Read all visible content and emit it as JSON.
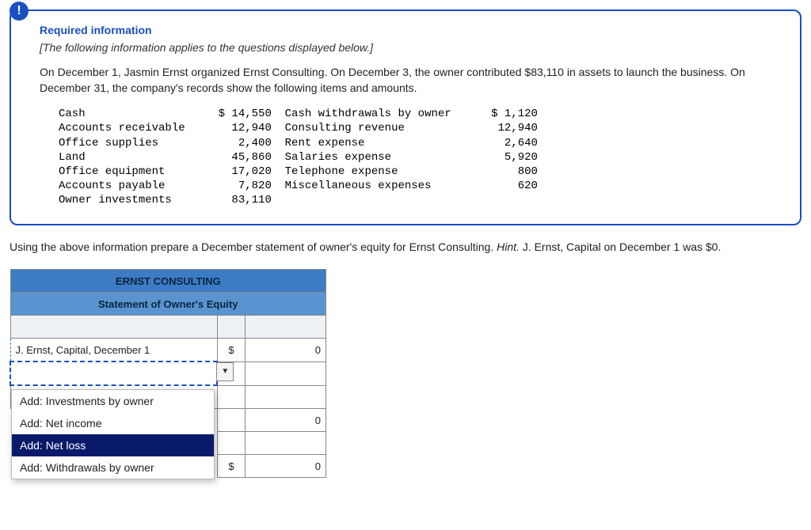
{
  "info": {
    "title": "Required information",
    "subtitle": "[The following information applies to the questions displayed below.]",
    "paragraph": "On December 1, Jasmin Ernst organized Ernst Consulting. On December 3, the owner contributed $83,110 in assets to launch the business. On December 31, the company's records show the following items and amounts."
  },
  "ledger": {
    "left": [
      {
        "name": "Cash",
        "amount": "$ 14,550"
      },
      {
        "name": "Accounts receivable",
        "amount": "12,940"
      },
      {
        "name": "Office supplies",
        "amount": "2,400"
      },
      {
        "name": "Land",
        "amount": "45,860"
      },
      {
        "name": "Office equipment",
        "amount": "17,020"
      },
      {
        "name": "Accounts payable",
        "amount": "7,820"
      },
      {
        "name": "Owner investments",
        "amount": "83,110"
      }
    ],
    "right": [
      {
        "name": "Cash withdrawals by owner",
        "amount": "$ 1,120"
      },
      {
        "name": "Consulting revenue",
        "amount": "12,940"
      },
      {
        "name": "Rent expense",
        "amount": "2,640"
      },
      {
        "name": "Salaries expense",
        "amount": "5,920"
      },
      {
        "name": "Telephone expense",
        "amount": "800"
      },
      {
        "name": "Miscellaneous expenses",
        "amount": "620"
      }
    ]
  },
  "instruction": {
    "text_a": "Using the above information prepare a December statement of owner's equity for Ernst Consulting. ",
    "hint_label": "Hint.",
    "text_b": " J. Ernst, Capital on December 1 was $0."
  },
  "worksheet": {
    "header1": "ERNST CONSULTING",
    "header2": "Statement of Owner's Equity",
    "row1_label": "J. Ernst, Capital, December 1",
    "dollar": "$",
    "zero": "0"
  },
  "dropdown": {
    "items": [
      "Add: Investments by owner",
      "Add: Net income",
      "Add: Net loss",
      "Add: Withdrawals by owner"
    ],
    "highlighted_index": 2
  }
}
